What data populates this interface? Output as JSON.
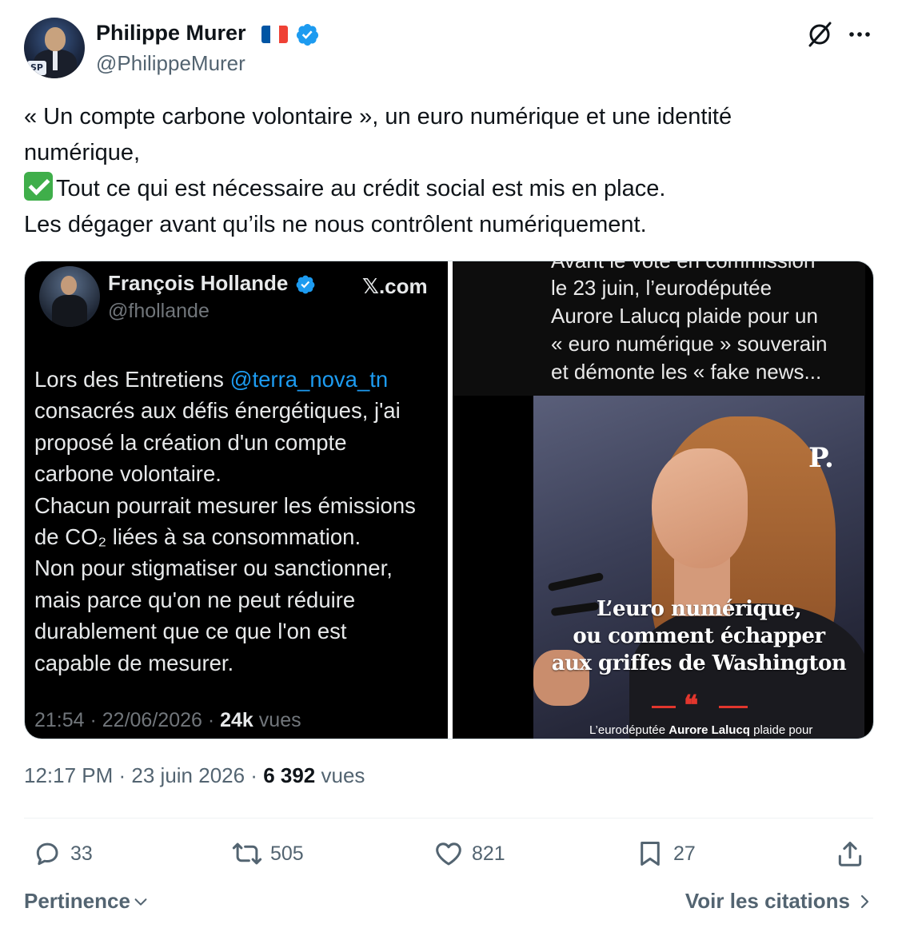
{
  "author": {
    "name": "Philippe Murer",
    "handle": "@PhilippeMurer",
    "flag_colors": [
      "#0055a4",
      "#ffffff",
      "#ef4135"
    ],
    "verified_color": "#1d9bf0"
  },
  "tweet": {
    "lines": [
      "« Un compte carbone volontaire », un euro numérique et une identité",
      "numérique,",
      "Tout ce qui est nécessaire au crédit social est mis en place.",
      "Les dégager avant qu’ils ne nous contrôlent numériquement."
    ],
    "check_icon": "white-check-mark-emoji"
  },
  "media_left": {
    "avatar_label": "",
    "name": "François Hollande",
    "handle": "@fhollande",
    "source": "𝕏.com",
    "body": {
      "line1_prefix": "Lors des Entretiens ",
      "line1_mention": "@terra_nova_tn",
      "lines": [
        "consacrés aux défis énergétiques, j'ai",
        "proposé la création d'un compte",
        "carbone volontaire.",
        "Chacun pourrait mesurer les émissions",
        "de CO₂ liées à sa consommation.",
        "Non pour stigmatiser ou sanctionner,",
        "mais parce qu'on ne peut réduire",
        "durablement que ce que l'on est",
        "capable de mesurer."
      ]
    },
    "footer": {
      "time": "21:54 · 22/06/2026 · ",
      "views_count": "24k",
      "views_label": " vues"
    }
  },
  "media_right": {
    "top_lines": [
      "Avant le vote en commission",
      "le 23 juin, l’eurodéputée",
      "Aurore Lalucq plaide pour un",
      "« euro numérique » souverain",
      "et démonte les « fake news..."
    ],
    "logo": "P.",
    "headline": [
      "L’euro numérique,",
      "ou comment échapper",
      "aux griffes de Washington"
    ],
    "quote_mark": "❝",
    "caption_prefix": "L’eurodéputée ",
    "caption_bold": "Aurore Lalucq",
    "caption_suffix": " plaide pour"
  },
  "meta": {
    "time_date": "12:17 PM · 23 juin 2026 · ",
    "views_count": "6 392",
    "views_label": " vues"
  },
  "actions": {
    "replies": "33",
    "reposts": "505",
    "likes": "821",
    "bookmarks": "27"
  },
  "footer": {
    "sort_label": "Pertinence",
    "quotes_label": "Voir les citations"
  }
}
